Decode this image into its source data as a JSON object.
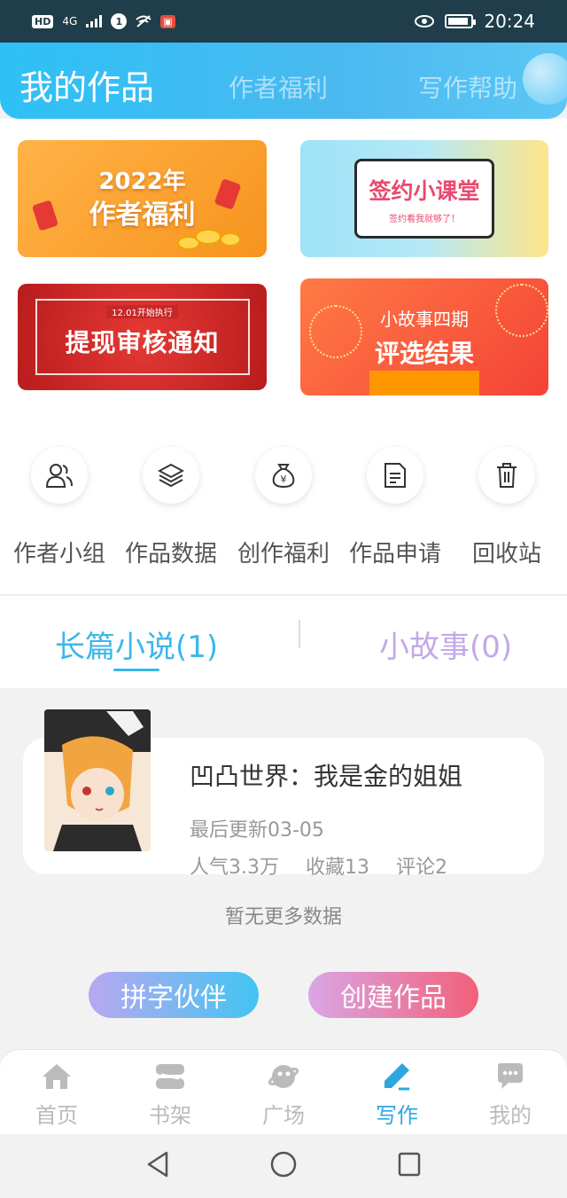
{
  "status_bar": {
    "left_icons": [
      "HD",
      "4G",
      "signal-icon",
      "1",
      "wifi-off-icon",
      "app-notification-icon"
    ],
    "time": "20:24",
    "battery_fraction": 0.9
  },
  "header": {
    "tabs": [
      {
        "label": "我的作品",
        "active": true
      },
      {
        "label": "作者福利",
        "active": false
      },
      {
        "label": "写作帮助",
        "active": false
      }
    ]
  },
  "banners": [
    {
      "line1": "2022年",
      "line2": "作者福利"
    },
    {
      "title": "签约小课堂",
      "subtitle": "签约看我就够了！"
    },
    {
      "small": "12.01开始执行",
      "title": "提现审核通知"
    },
    {
      "line1": "小故事四期",
      "line2": "评选结果"
    }
  ],
  "quick_actions": [
    {
      "label": "作者小组",
      "icon": "users-icon"
    },
    {
      "label": "作品数据",
      "icon": "layers-icon"
    },
    {
      "label": "创作福利",
      "icon": "money-bag-icon"
    },
    {
      "label": "作品申请",
      "icon": "document-icon"
    },
    {
      "label": "回收站",
      "icon": "trash-icon"
    }
  ],
  "work_tabs": [
    {
      "label": "长篇小说(1)",
      "active": true
    },
    {
      "label": "小故事(0)",
      "active": false
    }
  ],
  "works": [
    {
      "title": "凹凸世界：我是金的姐姐",
      "updated": "最后更新03-05",
      "popularity": "人气3.3万",
      "favorites": "收藏13",
      "comments": "评论2"
    }
  ],
  "no_more_text": "暂无更多数据",
  "actions": {
    "partner": "拼字伙伴",
    "create": "创建作品"
  },
  "bottom_nav": [
    {
      "label": "首页",
      "icon": "home-icon",
      "active": false
    },
    {
      "label": "书架",
      "icon": "bookshelf-icon",
      "active": false
    },
    {
      "label": "广场",
      "icon": "planet-icon",
      "active": false
    },
    {
      "label": "写作",
      "icon": "pen-icon",
      "active": true
    },
    {
      "label": "我的",
      "icon": "chat-icon",
      "active": false
    }
  ],
  "colors": {
    "accent": "#2ea7e0",
    "header_gradient_start": "#2ec1f5",
    "inactive_nav": "#bbbbbb"
  }
}
